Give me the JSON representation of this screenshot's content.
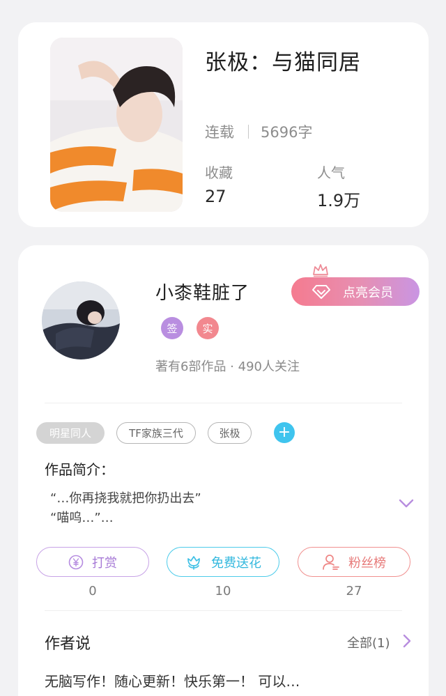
{
  "book": {
    "title": "张极：与猫同居",
    "status": "连载",
    "word_count": "5696字",
    "stats": [
      {
        "label": "收藏",
        "value": "27"
      },
      {
        "label": "人气",
        "value": "1.9万"
      }
    ]
  },
  "author": {
    "name": "小桼鞋脏了",
    "badges": [
      {
        "text": "签",
        "color": "#b98ee0"
      },
      {
        "text": "实",
        "color": "#f2888f"
      }
    ],
    "info": "著有6部作品 · 490人关注",
    "vip_button": "点亮会员"
  },
  "tags": [
    "明星同人",
    "TF家族三代",
    "张极"
  ],
  "tag_add_symbol": "+",
  "intro": {
    "title": "作品简介：",
    "text": "“…你再挠我就把你扔出去”\n“喵呜…”…"
  },
  "actions": [
    {
      "label": "打赏",
      "count": "0",
      "icon": "yen-coin-icon",
      "color": "#a77ad6"
    },
    {
      "label": "免费送花",
      "count": "10",
      "icon": "flower-icon",
      "color": "#33b8de"
    },
    {
      "label": "粉丝榜",
      "count": "27",
      "icon": "user-rank-icon",
      "color": "#e77a79"
    }
  ],
  "author_say": {
    "title": "作者说",
    "all_label": "全部(1)",
    "text": "无脑写作！随心更新！快乐第一！  可以…"
  }
}
